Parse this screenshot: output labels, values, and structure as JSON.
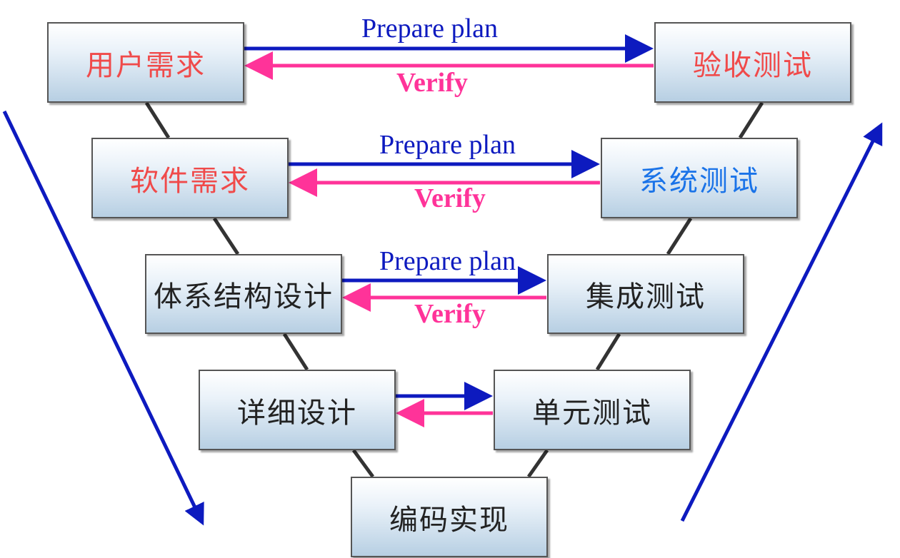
{
  "colors": {
    "red_text": "#f04a4a",
    "blue_text": "#1a73e8",
    "dark_text": "#222222",
    "plan_arrow": "#0d1abf",
    "verify_arrow": "#ff3399"
  },
  "left_column": [
    {
      "label": "用户需求"
    },
    {
      "label": "软件需求"
    },
    {
      "label": "体系结构设计"
    },
    {
      "label": "详细设计"
    }
  ],
  "right_column": [
    {
      "label": "验收测试"
    },
    {
      "label": "系统测试"
    },
    {
      "label": "集成测试"
    },
    {
      "label": "单元测试"
    }
  ],
  "bottom": {
    "label": "编码实现"
  },
  "links": [
    {
      "plan": "Prepare plan",
      "verify": "Verify"
    },
    {
      "plan": "Prepare plan",
      "verify": "Verify"
    },
    {
      "plan": "Prepare plan",
      "verify": "Verify"
    }
  ]
}
